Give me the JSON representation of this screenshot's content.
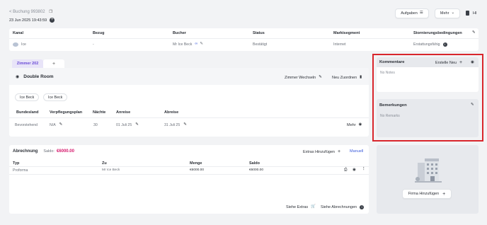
{
  "header": {
    "back_label": "< Buchung 993802",
    "datetime": "23 Jun 2025 19:43:59",
    "tasks_label": "Aufgaben",
    "more_label": "Mehr",
    "user_initials": "HI"
  },
  "booking_table": {
    "columns": [
      "Kanal",
      "Bezug",
      "Bucher",
      "Status",
      "Marktsegment",
      "Stornierungsbedingungen"
    ],
    "row": {
      "kanal": "Ice",
      "bezug": "-",
      "bucher": "Mr Ice Beck",
      "status": "Bestätigt",
      "marktsegment": "Internet",
      "storno": "Erstattungsfähig"
    }
  },
  "room_tab": {
    "active_tab": "Zimmer 202",
    "add_tab": "+",
    "room_type": "Double Room",
    "change_room_label": "Zimmer Wechseln",
    "reassign_label": "Neu Zuordnen",
    "guests": [
      "Ice Beck",
      "Ice Beck"
    ],
    "columns": [
      "Bundesland",
      "Verpflegungsplan",
      "Nächte",
      "Anreise",
      "Abreise"
    ],
    "row": {
      "bundesland": "Bevorstehend",
      "verpflegung": "N/A",
      "naechte": "30",
      "anreise": "01 Juli 25",
      "abreise": "31 Juli 25"
    },
    "more_label": "Mehr"
  },
  "billing": {
    "title": "Abrechnung",
    "saldo_label": "Saldo:",
    "saldo_value": "€6000.00",
    "add_extras_label": "Extras Hinzufügen",
    "manual_label": "Manuell",
    "columns": [
      "Typ",
      "Zu",
      "Menge",
      "Saldo"
    ],
    "row": {
      "typ": "Proforma",
      "zu": "Mr Ice Beck",
      "menge": "€6000.00",
      "saldo": "€6000.00"
    },
    "see_extras_label": "Siehe Extras",
    "see_billing_label": "Siehe Abrechnungen"
  },
  "comments": {
    "title": "Kommentare",
    "create_label": "Erstelle Neu",
    "empty_text": "No Notes"
  },
  "remarks": {
    "title": "Bemerkungen",
    "empty_text": "No Remarks"
  },
  "company": {
    "add_label": "Firma Hinzufügen"
  },
  "colors": {
    "accent_pink": "#d5176b",
    "accent_blue": "#3b5bdb",
    "highlight_red": "#d9262c",
    "tab_purple": "#6a4bd6"
  }
}
